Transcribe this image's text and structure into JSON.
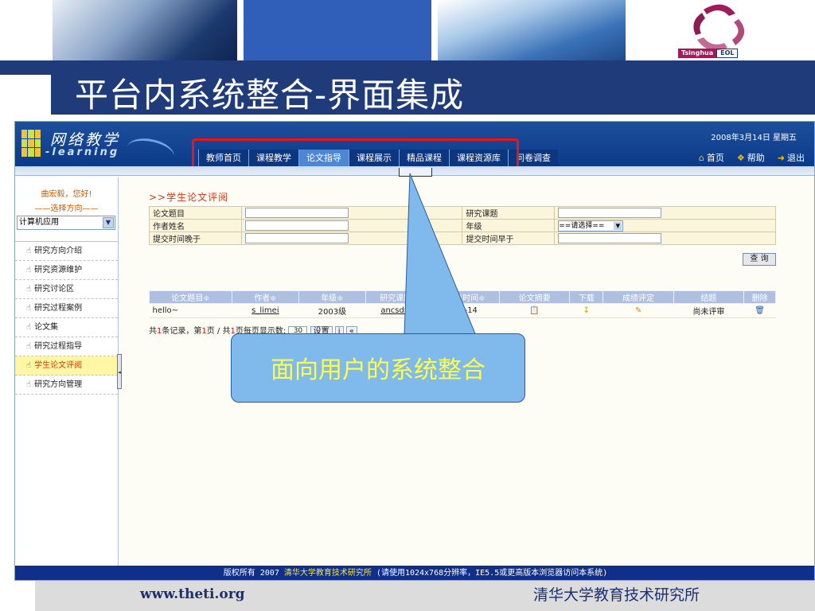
{
  "slide": {
    "title": "平台内系统整合-界面集成",
    "footer_url": "www.theti.org",
    "footer_org": "清华大学教育技术研究所",
    "brand_logo": {
      "text_left": "Tsinghua",
      "text_right": "EOL"
    },
    "callout": "面向用户的系统整合"
  },
  "app": {
    "logo_cn": "网络教学",
    "logo_en": "-learning",
    "date": "2008年3月14日 星期五",
    "nav": [
      {
        "label": "教师首页"
      },
      {
        "label": "课程教学"
      },
      {
        "label": "论文指导"
      },
      {
        "label": "课程展示"
      },
      {
        "label": "精品课程"
      },
      {
        "label": "课程资源库"
      },
      {
        "label": "问卷调查"
      }
    ],
    "nav_active_index": 2,
    "top_links": [
      {
        "icon": "home-icon",
        "label": "首页"
      },
      {
        "icon": "help-icon",
        "label": "帮助"
      },
      {
        "icon": "exit-icon",
        "label": "退出"
      }
    ],
    "sidebar": {
      "greeting": "曲宏毅，您好!",
      "direction_label": "——选择方向——",
      "direction_value": "计算机应用",
      "items": [
        {
          "label": "研究方向介绍"
        },
        {
          "label": "研究资源维护"
        },
        {
          "label": "研究讨论区"
        },
        {
          "label": "研究过程案例"
        },
        {
          "label": "论文集"
        },
        {
          "label": "研究过程指导"
        },
        {
          "label": "学生论文评阅"
        },
        {
          "label": "研究方向管理"
        }
      ],
      "active_index": 6
    },
    "query": {
      "title": ">>学生论文评阅",
      "rows": [
        {
          "l1": "论文题目",
          "l2": "研究课题"
        },
        {
          "l1": "作者姓名",
          "l2": "年级"
        },
        {
          "l1": "提交时间晚于",
          "l2": "提交时间早于"
        }
      ],
      "grade_select": "==请选择==",
      "query_button": "查 询"
    },
    "results": {
      "headers": [
        "论文题目≑",
        "作者≑",
        "年级≑",
        "研究课题≑",
        "提交时间≑",
        "论文摘要",
        "下载",
        "成绩评定",
        "结题",
        "删除"
      ],
      "rows": [
        {
          "title": "hello~",
          "author": "s_limei",
          "grade": "2003级",
          "topic": "ancsdrad",
          "time": "11-14",
          "status": "尚未评审"
        }
      ],
      "pager": {
        "p1": "共",
        "count": "1",
        "p2": "条记录，第",
        "page": "1",
        "p3": "页 / 共",
        "total_pages": "1",
        "p4": "页每页显示数:",
        "per_page": "30",
        "set_button": "设置"
      }
    },
    "footer": {
      "prefix": "版权所有 2007",
      "org": "清华大学教育技术研究所",
      "suffix": "(请使用1024x768分辨率，IE5.5或更高版本浏览器访问本系统)"
    }
  }
}
